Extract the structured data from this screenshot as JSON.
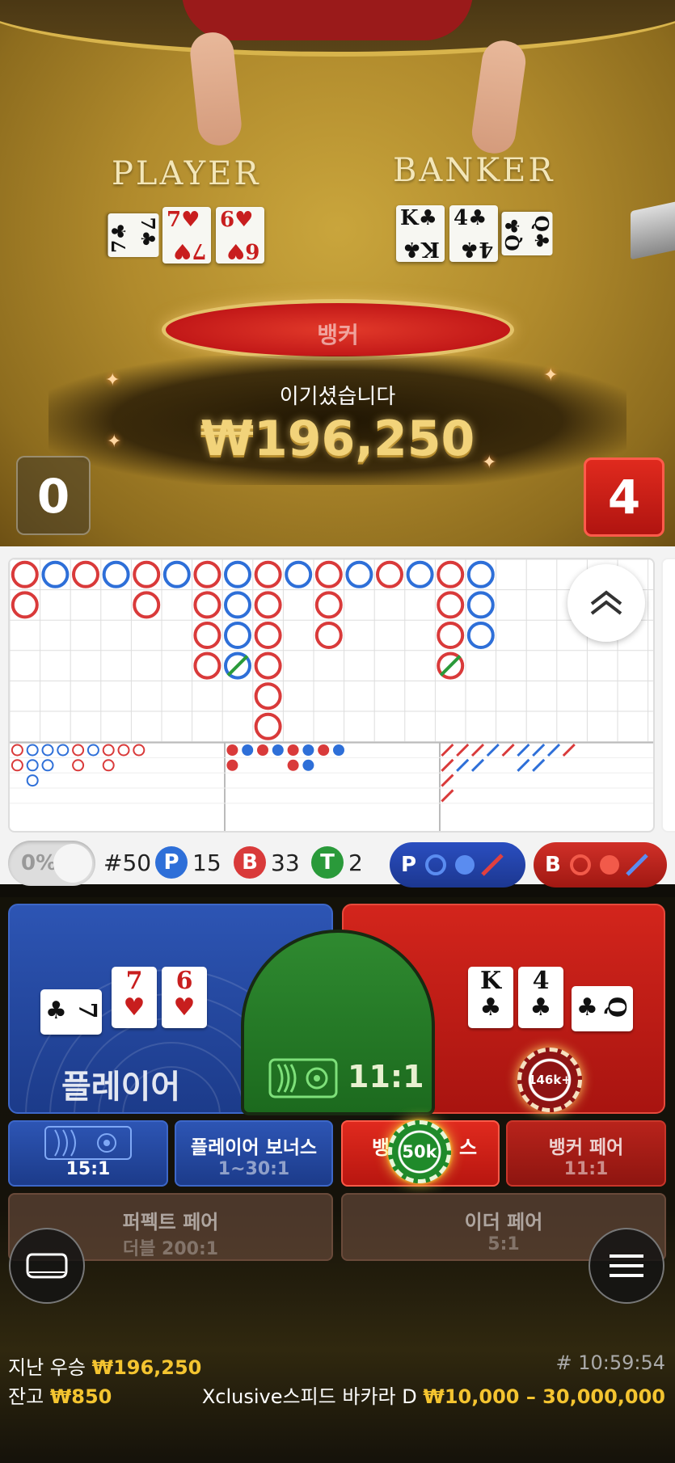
{
  "video": {
    "player_label": "PLAYER",
    "banker_label": "BANKER",
    "player_cards": [
      {
        "rank": "7",
        "suit": "♣",
        "color": "black",
        "rotated": true
      },
      {
        "rank": "7",
        "suit": "♥",
        "color": "red"
      },
      {
        "rank": "6",
        "suit": "♥",
        "color": "red"
      }
    ],
    "banker_cards": [
      {
        "rank": "K",
        "suit": "♣",
        "color": "black"
      },
      {
        "rank": "4",
        "suit": "♣",
        "color": "black"
      },
      {
        "rank": "Q",
        "suit": "♣",
        "color": "black",
        "rotated": true
      }
    ],
    "result_text": "뱅커",
    "win_title": "이기셨습니다",
    "win_amount": "₩196,250",
    "player_score": "0",
    "banker_score": "4"
  },
  "bead_road": {
    "cols": 21,
    "rows": 6,
    "columns": [
      [
        "B",
        "B"
      ],
      [
        "P"
      ],
      [
        "B"
      ],
      [
        "P"
      ],
      [
        "B",
        "B"
      ],
      [
        "P"
      ],
      [
        "B",
        "B",
        "B",
        "B"
      ],
      [
        "P",
        "P",
        "P",
        "P"
      ],
      [
        "B",
        "B",
        "B",
        "B",
        "B",
        "B"
      ],
      [
        "P"
      ],
      [
        "B",
        "B",
        "B"
      ],
      [
        "P"
      ],
      [
        "B"
      ],
      [
        "P"
      ],
      [
        "B",
        "B",
        "B",
        "B"
      ],
      [
        "P",
        "P",
        "P"
      ]
    ],
    "tie_marks": [
      [
        7,
        3
      ],
      [
        14,
        3
      ]
    ],
    "colors": {
      "player": "#2e6fd8",
      "banker": "#d93a3a",
      "tie": "#2a9a3a"
    }
  },
  "derived_roads": {
    "big_eye": [
      [
        "B",
        "B"
      ],
      [
        "P",
        "P",
        "P"
      ],
      [
        "P",
        "P"
      ],
      [
        "P"
      ],
      [
        "B",
        "B"
      ],
      [
        "P"
      ],
      [
        "B",
        "B"
      ],
      [
        "B"
      ],
      [
        "B"
      ]
    ],
    "small_road": [
      [
        "B",
        "B"
      ],
      [
        "P"
      ],
      [
        "B"
      ],
      [
        "P"
      ],
      [
        "B",
        "B"
      ],
      [
        "P",
        "P"
      ],
      [
        "B"
      ],
      [
        "P"
      ]
    ],
    "cockroach": [
      [
        "B",
        "B",
        "B",
        "B"
      ],
      [
        "B",
        "P"
      ],
      [
        "B",
        "P"
      ],
      [
        "P"
      ],
      [
        "B"
      ],
      [
        "P",
        "P"
      ],
      [
        "P",
        "P"
      ],
      [
        "P"
      ],
      [
        "B"
      ]
    ]
  },
  "stats": {
    "percent": "0%",
    "round": "#50",
    "player_badge": "P",
    "player_count": "15",
    "banker_badge": "B",
    "banker_count": "33",
    "tie_badge": "T",
    "tie_count": "2",
    "predict_player": "P",
    "predict_banker": "B"
  },
  "bets": {
    "player": {
      "label": "플레이어",
      "cards": [
        {
          "rank": "7",
          "suit": "♣",
          "color": "black",
          "side": true
        },
        {
          "rank": "7",
          "suit": "♥",
          "color": "red"
        },
        {
          "rank": "6",
          "suit": "♥",
          "color": "red"
        }
      ]
    },
    "banker": {
      "cards": [
        {
          "rank": "K",
          "suit": "♣",
          "color": "black"
        },
        {
          "rank": "4",
          "suit": "♣",
          "color": "black"
        },
        {
          "rank": "Q",
          "suit": "♣",
          "color": "black",
          "side": true
        }
      ],
      "chip": "146k+"
    },
    "tie": {
      "odds": "11:1"
    },
    "dragon_odds": "15:1",
    "player_bonus": {
      "label": "플레이어 보너스",
      "odds": "1~30:1"
    },
    "banker_bonus": {
      "label_left": "뱅",
      "label_right": "스",
      "chip": "50k"
    },
    "banker_pair": {
      "label": "뱅커 페어",
      "odds": "11:1"
    },
    "perfect_pair": {
      "label": "퍼펙트 페어",
      "odds": "더블 200:1"
    },
    "either_pair": {
      "label": "이더 페어",
      "odds": "5:1"
    }
  },
  "footer": {
    "last_win_label": "지난 우승",
    "last_win_value": "₩196,250",
    "balance_label": "잔고",
    "balance_value": "₩850",
    "round_id": "# 10:59:54",
    "table_name": "Xclusive스피드 바카라 D",
    "limits": "₩10,000 – 30,000,000"
  }
}
